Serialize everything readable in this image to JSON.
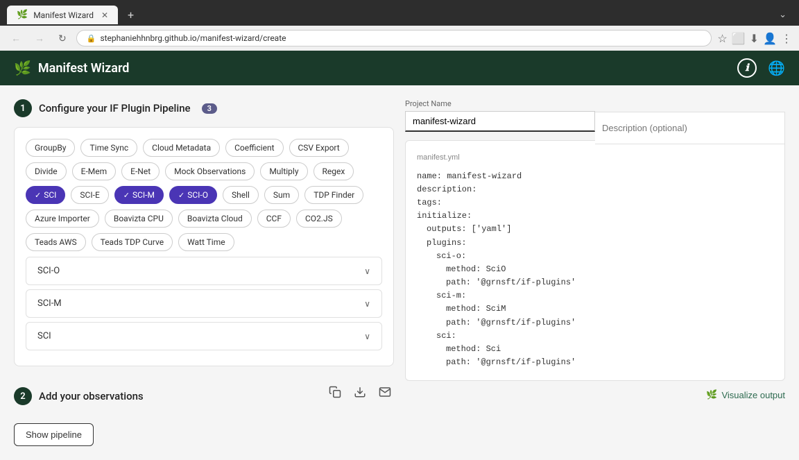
{
  "browser": {
    "tab_title": "Manifest Wizard",
    "url": "stephaniehhnbrg.github.io/manifest-wizard/create",
    "nav_back": "←",
    "nav_forward": "→",
    "nav_refresh": "↻",
    "new_tab": "+"
  },
  "header": {
    "logo_text": "Manifest Wizard",
    "info_icon": "ℹ",
    "globe_icon": "🌐"
  },
  "step1": {
    "number": "1",
    "title": "Configure your IF Plugin Pipeline",
    "badge": "3",
    "pills": [
      {
        "label": "GroupBy",
        "active": false
      },
      {
        "label": "Time Sync",
        "active": false
      },
      {
        "label": "Cloud Metadata",
        "active": false
      },
      {
        "label": "Coefficient",
        "active": false
      },
      {
        "label": "CSV Export",
        "active": false
      },
      {
        "label": "Divide",
        "active": false
      },
      {
        "label": "E-Mem",
        "active": false
      },
      {
        "label": "E-Net",
        "active": false
      },
      {
        "label": "Mock Observations",
        "active": false
      },
      {
        "label": "Multiply",
        "active": false
      },
      {
        "label": "Regex",
        "active": false
      },
      {
        "label": "SCI",
        "active": true
      },
      {
        "label": "SCI-E",
        "active": false
      },
      {
        "label": "SCI-M",
        "active": true
      },
      {
        "label": "SCI-O",
        "active": true
      },
      {
        "label": "Shell",
        "active": false
      },
      {
        "label": "Sum",
        "active": false
      },
      {
        "label": "TDP Finder",
        "active": false
      },
      {
        "label": "Azure Importer",
        "active": false
      },
      {
        "label": "Boavizta CPU",
        "active": false
      },
      {
        "label": "Boavizta Cloud",
        "active": false
      },
      {
        "label": "CCF",
        "active": false
      },
      {
        "label": "CO2.JS",
        "active": false
      },
      {
        "label": "Teads AWS",
        "active": false
      },
      {
        "label": "Teads TDP Curve",
        "active": false
      },
      {
        "label": "Watt Time",
        "active": false
      }
    ],
    "accordion": [
      {
        "label": "SCI-O"
      },
      {
        "label": "SCI-M"
      },
      {
        "label": "SCI"
      }
    ]
  },
  "project": {
    "name_label": "Project Name",
    "name_value": "manifest-wizard",
    "description_placeholder": "Description (optional)"
  },
  "yaml": {
    "label": "manifest.yml",
    "content": [
      "name: manifest-wizard",
      "description:",
      "tags:",
      "initialize:",
      "  outputs: ['yaml']",
      "  plugins:",
      "    sci-o:",
      "      method: SciO",
      "      path: '@grnsft/if-plugins'",
      "    sci-m:",
      "      method: SciM",
      "      path: '@grnsft/if-plugins'",
      "    sci:",
      "      method: Sci",
      "      path: '@grnsft/if-plugins'"
    ]
  },
  "step2": {
    "number": "2",
    "title": "Add your observations",
    "copy_icon": "⧉",
    "download_icon": "⬇",
    "email_icon": "✉",
    "visualize_label": "Visualize output"
  },
  "show_pipeline": {
    "label": "Show pipeline"
  }
}
